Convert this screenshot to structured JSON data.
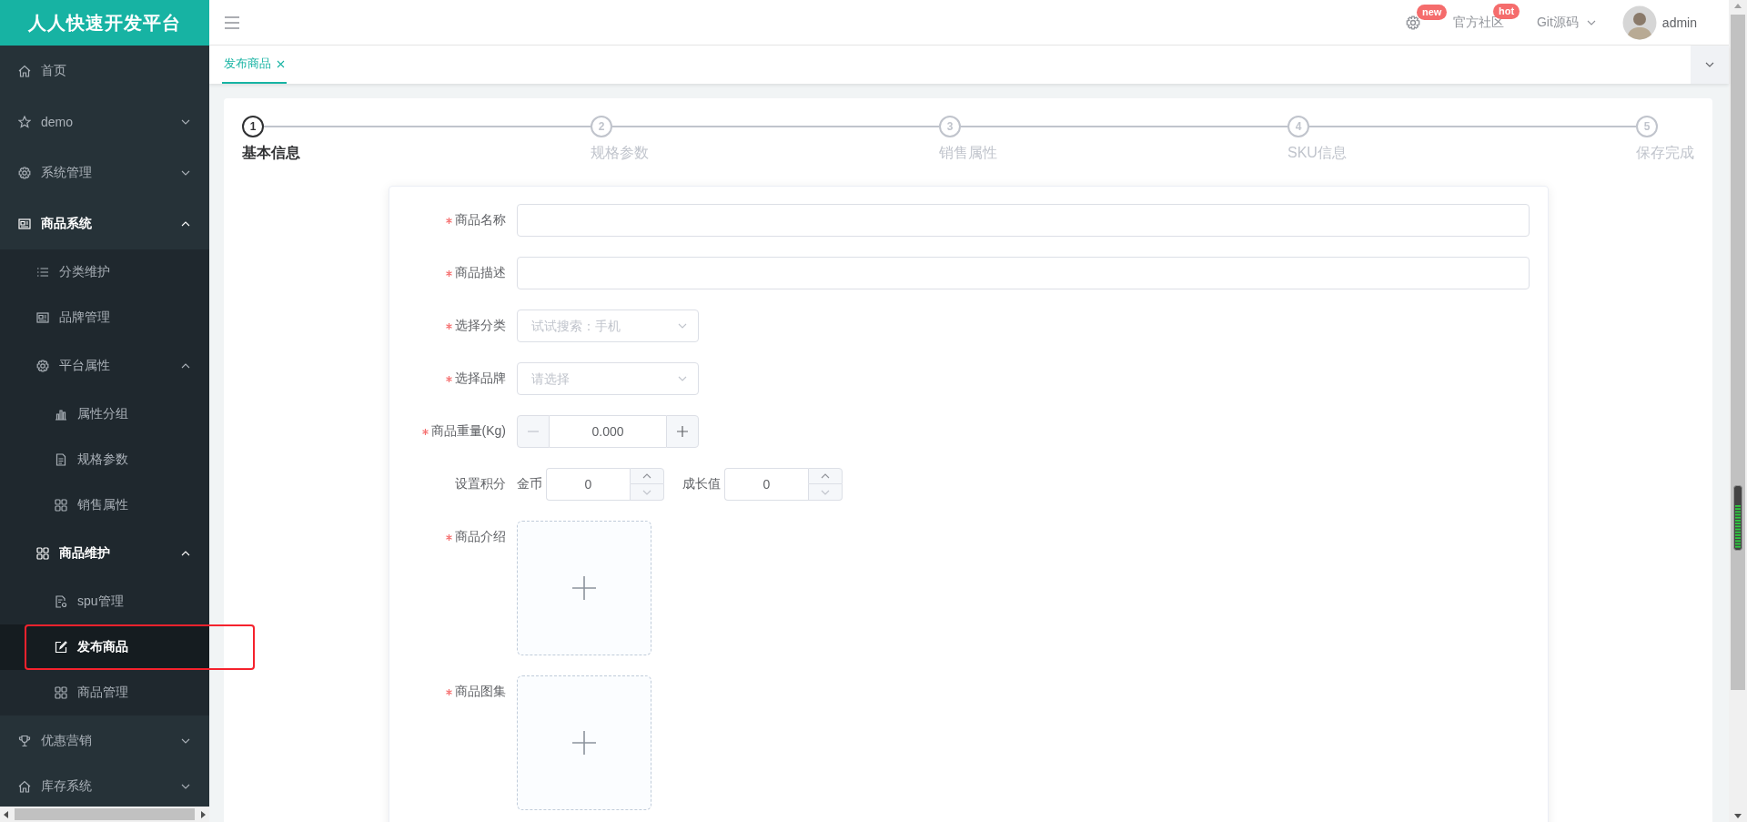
{
  "brand": {
    "title": "人人快速开发平台"
  },
  "sidebar": {
    "items": [
      {
        "label": "首页",
        "selected": false
      },
      {
        "label": "demo",
        "selected": false,
        "expanded": false
      },
      {
        "label": "系统管理",
        "selected": false,
        "expanded": false
      },
      {
        "label": "商品系统",
        "selected": false,
        "expanded": true,
        "children": [
          {
            "label": "分类维护",
            "selected": false
          },
          {
            "label": "品牌管理",
            "selected": false
          },
          {
            "label": "平台属性",
            "selected": false,
            "expanded": true,
            "children": [
              {
                "label": "属性分组",
                "selected": false
              },
              {
                "label": "规格参数",
                "selected": false
              },
              {
                "label": "销售属性",
                "selected": false
              }
            ]
          },
          {
            "label": "商品维护",
            "selected": false,
            "expanded": true,
            "children": [
              {
                "label": "spu管理",
                "selected": false
              },
              {
                "label": "发布商品",
                "selected": true,
                "highlighted": true
              },
              {
                "label": "商品管理",
                "selected": false
              }
            ]
          }
        ]
      },
      {
        "label": "优惠营销",
        "selected": false,
        "expanded": false
      },
      {
        "label": "库存系统",
        "selected": false,
        "expanded": false
      }
    ]
  },
  "header": {
    "links": [
      {
        "kind": "settings",
        "badge": "new"
      },
      {
        "kind": "link",
        "label": "官方社区",
        "badge": "hot"
      },
      {
        "kind": "dropdown",
        "label": "Git源码"
      }
    ],
    "user": {
      "name": "admin"
    }
  },
  "tabs": [
    {
      "label": "发布商品",
      "selected": true
    }
  ],
  "steps": [
    {
      "number": "1",
      "label": "基本信息",
      "active": true
    },
    {
      "number": "2",
      "label": "规格参数",
      "active": false
    },
    {
      "number": "3",
      "label": "销售属性",
      "active": false
    },
    {
      "number": "4",
      "label": "SKU信息",
      "active": false
    },
    {
      "number": "5",
      "label": "保存完成",
      "active": false
    }
  ],
  "form": {
    "fields": [
      {
        "kind": "text",
        "label": "商品名称",
        "required": true
      },
      {
        "kind": "text",
        "label": "商品描述",
        "required": true
      },
      {
        "kind": "select",
        "label": "选择分类",
        "required": true,
        "placeholder": "试试搜索：手机"
      },
      {
        "kind": "select",
        "label": "选择品牌",
        "required": true,
        "placeholder": "请选择"
      },
      {
        "kind": "stepper",
        "label": "商品重量(Kg)",
        "required": true,
        "value": "0.000"
      },
      {
        "kind": "points",
        "label": "设置积分",
        "required": false,
        "inputs": [
          {
            "label": "金币",
            "value": "0"
          },
          {
            "label": "成长值",
            "value": "0"
          }
        ]
      },
      {
        "kind": "upload",
        "label": "商品介绍",
        "required": true
      },
      {
        "kind": "upload",
        "label": "商品图集",
        "required": true
      }
    ]
  }
}
